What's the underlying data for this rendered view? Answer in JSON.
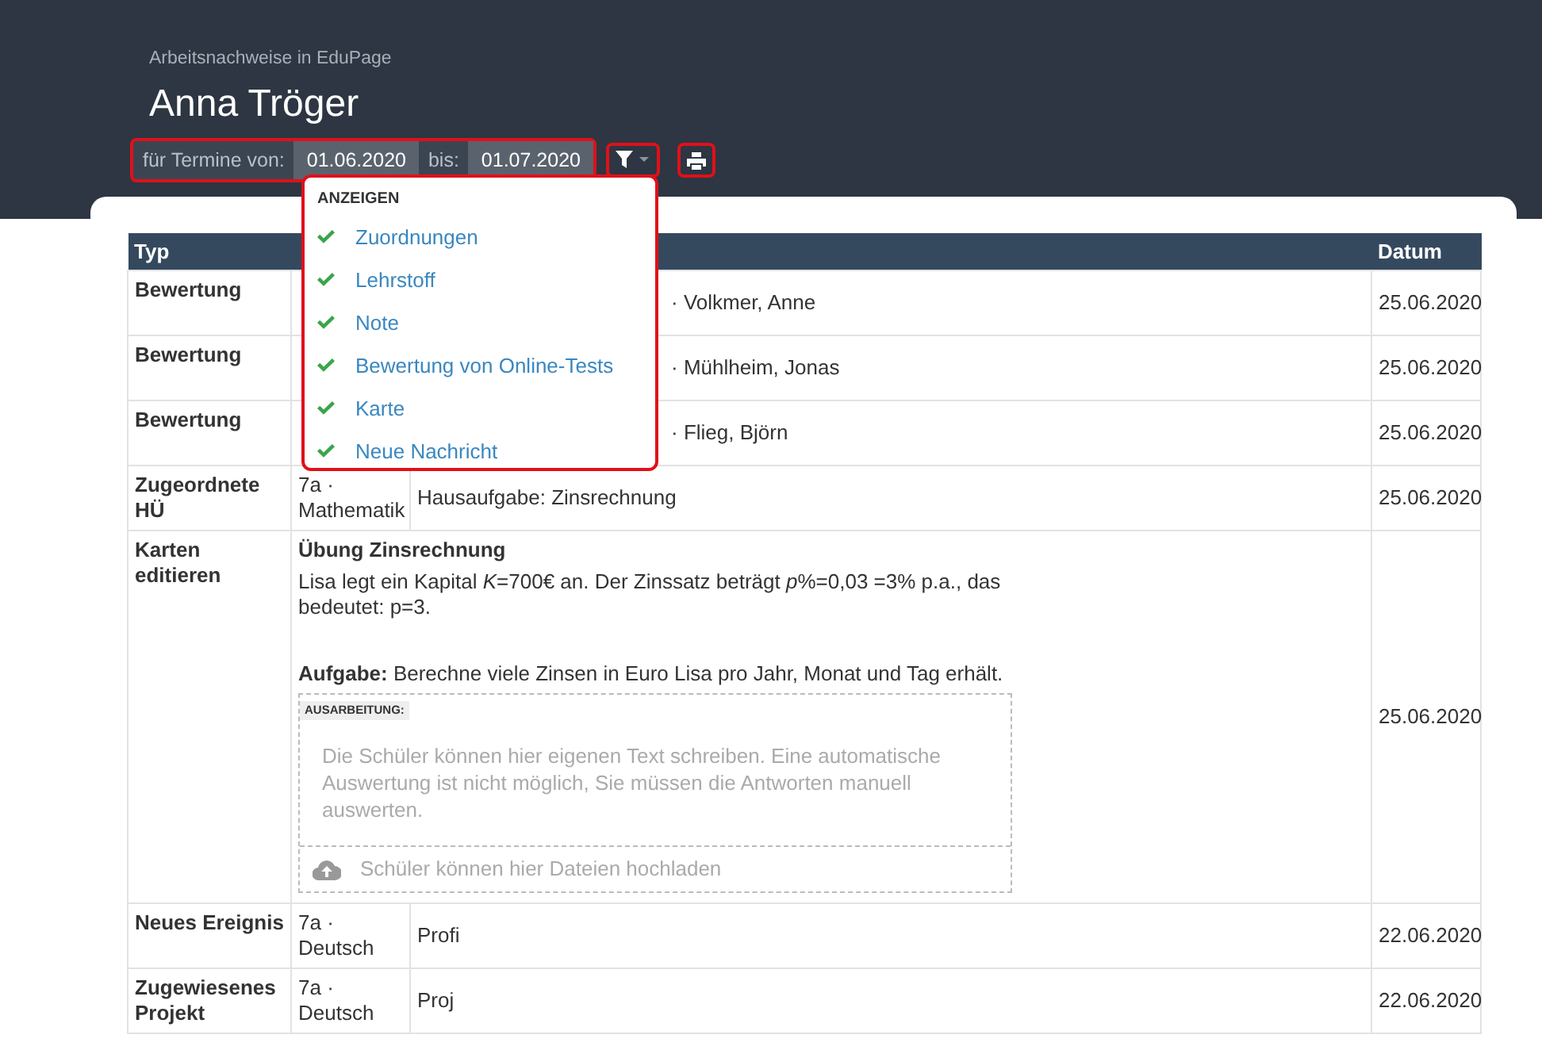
{
  "header": {
    "subtitle": "Arbeitsnachweise in EduPage",
    "title": "Anna Tröger"
  },
  "date_filter": {
    "from_label": "für Termine von:",
    "from": "01.06.2020",
    "to_label": "bis:",
    "to": "01.07.2020"
  },
  "dropdown": {
    "heading": "ANZEIGEN",
    "items": [
      {
        "label": "Zuordnungen",
        "checked": true
      },
      {
        "label": "Lehrstoff",
        "checked": true
      },
      {
        "label": "Note",
        "checked": true
      },
      {
        "label": "Bewertung von Online-Tests",
        "checked": true
      },
      {
        "label": "Karte",
        "checked": true
      },
      {
        "label": "Neue Nachricht",
        "checked": true
      }
    ]
  },
  "table": {
    "columns": [
      "Typ",
      "Datum"
    ],
    "rows": [
      {
        "kind": "covered",
        "type": "Bewertung",
        "content": "· Volkmer, Anne",
        "date": "25.06.2020"
      },
      {
        "kind": "covered",
        "type": "Bewertung",
        "content": "· Mühlheim, Jonas",
        "date": "25.06.2020"
      },
      {
        "kind": "covered",
        "type": "Bewertung",
        "content": "· Flieg, Björn",
        "date": "25.06.2020"
      },
      {
        "kind": "plain",
        "type": "Zugeordnete HÜ",
        "class": "7a · Mathematik",
        "content": "Hausaufgabe: Zinsrechnung",
        "date": "25.06.2020"
      },
      {
        "kind": "card",
        "type": "Karten editieren",
        "title": "Übung Zinsrechnung",
        "text": "Lisa legt ein Kapital *K*=700€ an. Der Zinssatz beträgt *p*%=0,03 =3% p.a., das bedeutet: p=3.",
        "task": "**Aufgabe:** Berechne viele Zinsen in Euro Lisa pro Jahr, Monat und Tag erhält.",
        "answer": {
          "label": "AUSARBEITUNG:",
          "placeholder": "Die Schüler können hier eigenen Text schreiben. Eine automatische Auswertung ist nicht möglich, Sie müssen die Antworten manuell auswerten.",
          "upload": "Schüler können hier Dateien hochladen"
        },
        "date": "25.06.2020"
      },
      {
        "kind": "plain",
        "type": "Neues Ereignis",
        "class": "7a · Deutsch",
        "content": "Profi",
        "date": "22.06.2020"
      },
      {
        "kind": "plain",
        "type": "Zugewiesenes Projekt",
        "class": "7a · Deutsch",
        "content": "Proj",
        "date": "22.06.2020"
      }
    ]
  }
}
